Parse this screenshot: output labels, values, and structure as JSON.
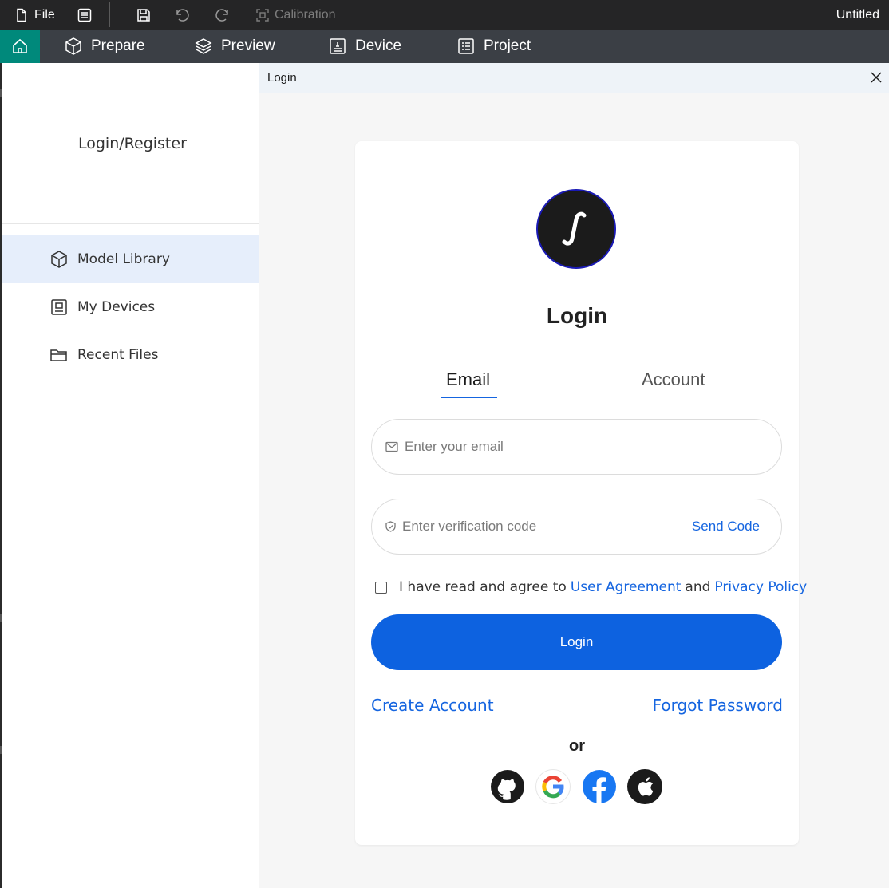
{
  "titlebar": {
    "file_label": "File",
    "calibration_label": "Calibration",
    "document_title": "Untitled"
  },
  "tabs": {
    "home_icon": "home-icon",
    "prepare": "Prepare",
    "preview": "Preview",
    "device": "Device",
    "project": "Project"
  },
  "sidebar": {
    "login_register": "Login/Register",
    "items": [
      {
        "label": "Model Library",
        "icon": "cube-icon",
        "active": true
      },
      {
        "label": "My Devices",
        "icon": "device-icon",
        "active": false
      },
      {
        "label": "Recent Files",
        "icon": "folder-icon",
        "active": false
      }
    ]
  },
  "dialog": {
    "title": "Login",
    "heading": "Login",
    "tabs": {
      "email": "Email",
      "account": "Account",
      "selected": "Email"
    },
    "email_placeholder": "Enter your email",
    "email_value": "",
    "code_placeholder": "Enter verification code",
    "code_value": "",
    "send_code": "Send Code",
    "agreement": {
      "prefix": "I have read and agree to",
      "user_agreement": "User Agreement",
      "and": "and",
      "privacy_policy": "Privacy Policy",
      "checked": false
    },
    "login_button": "Login",
    "create_account": "Create Account",
    "forgot_password": "Forgot Password",
    "or": "or",
    "social": [
      "github-icon",
      "google-icon",
      "facebook-icon",
      "apple-icon"
    ]
  },
  "colors": {
    "accent": "#0d62e0",
    "link": "#1565e0",
    "home_tab": "#00897b",
    "titlebar_bg": "#252526",
    "tabbar_bg": "#3b3f45",
    "sidebar_active": "#e6eefb"
  }
}
